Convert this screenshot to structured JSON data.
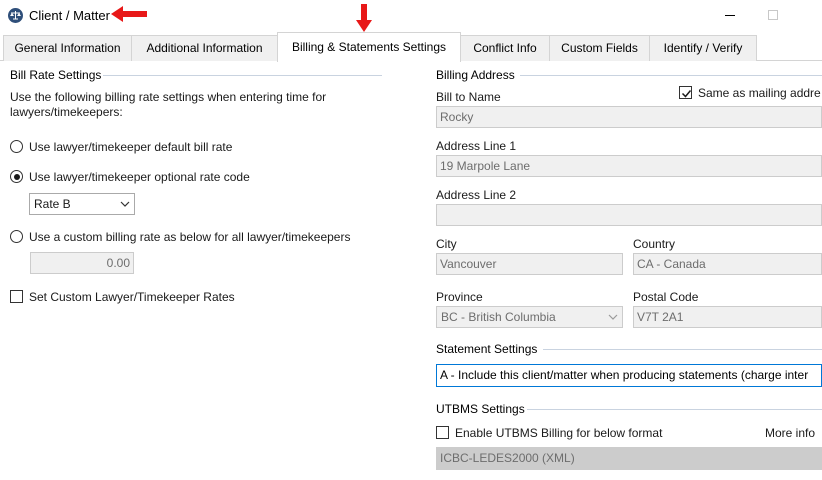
{
  "window": {
    "title": "Client / Matter"
  },
  "tabs": [
    {
      "label": "General Information"
    },
    {
      "label": "Additional Information"
    },
    {
      "label": "Billing & Statements Settings"
    },
    {
      "label": "Conflict Info"
    },
    {
      "label": "Custom Fields"
    },
    {
      "label": "Identify / Verify"
    }
  ],
  "bill_rate": {
    "title": "Bill Rate Settings",
    "description_line1": "Use the following billing rate settings when entering time for",
    "description_line2": "lawyers/timekeepers:",
    "option_default": "Use lawyer/timekeeper default bill rate",
    "option_optional": "Use lawyer/timekeeper optional rate code",
    "rate_code_value": "Rate B",
    "option_custom": "Use a custom billing rate as below for all lawyer/timekeepers",
    "custom_rate_value": "0.00",
    "set_custom_label": "Set Custom Lawyer/Timekeeper Rates",
    "selected_option": "optional",
    "set_custom_checked": false
  },
  "billing_address": {
    "title": "Billing Address",
    "bill_to_label": "Bill to Name",
    "same_as_mailing_label": "Same as mailing addre",
    "same_as_mailing_checked": true,
    "bill_to_value": "Rocky",
    "address1_label": "Address Line 1",
    "address1_value": "19 Marpole Lane",
    "address2_label": "Address Line 2",
    "address2_value": "",
    "city_label": "City",
    "city_value": "Vancouver",
    "country_label": "Country",
    "country_value": "CA - Canada",
    "province_label": "Province",
    "province_value": "BC - British Columbia",
    "postal_label": "Postal Code",
    "postal_value": "V7T 2A1"
  },
  "statement_settings": {
    "title": "Statement Settings",
    "value": "A - Include this client/matter when producing statements (charge inter"
  },
  "utbms": {
    "title": "UTBMS Settings",
    "enable_label": "Enable UTBMS Billing for below format",
    "enable_checked": false,
    "more_info_label": "More info",
    "format_value": "ICBC-LEDES2000 (XML)"
  },
  "colors": {
    "annotation_arrow": "#e81818",
    "focus_border": "#0078d7",
    "group_line": "#c9d3e0"
  }
}
